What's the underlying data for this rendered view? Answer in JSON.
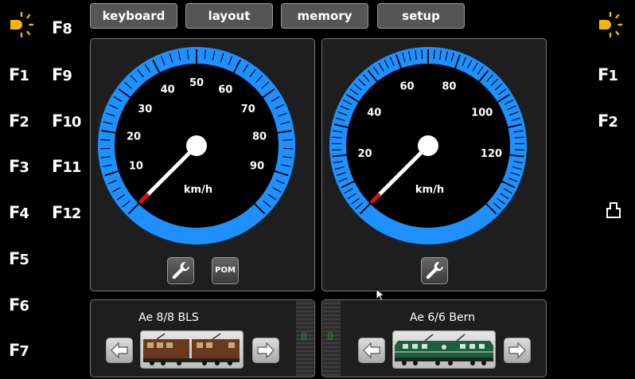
{
  "top_buttons": [
    {
      "label": "keyboard"
    },
    {
      "label": "layout"
    },
    {
      "label": "memory"
    },
    {
      "label": "setup"
    }
  ],
  "left_fkeys": [
    {
      "label": "F1"
    },
    {
      "label": "F2"
    },
    {
      "label": "F3"
    },
    {
      "label": "F4"
    },
    {
      "label": "F5"
    },
    {
      "label": "F6"
    },
    {
      "label": "F7"
    },
    {
      "label": "F8"
    },
    {
      "label": "F9"
    },
    {
      "label": "F10"
    },
    {
      "label": "F11"
    },
    {
      "label": "F12"
    }
  ],
  "right_fkeys": [
    {
      "label": "F1"
    },
    {
      "label": "F2"
    }
  ],
  "icons": {
    "light": "light-bulb-icon",
    "wrench": "wrench-icon",
    "coupler": "coupler-icon",
    "arrow_left": "arrow-left-icon",
    "arrow_right": "arrow-right-icon",
    "cursor": "mouse-cursor-icon"
  },
  "colors": {
    "gauge_ring": "#1e90ff",
    "needle": "#ffffff",
    "needle_tip": "#e01010",
    "light_on": "#f5b800",
    "meter_text": "#2a8a2a"
  },
  "throttles": [
    {
      "speed_unit": "km/h",
      "max_speed": 100,
      "current_speed": 0,
      "speed_labels": [
        10,
        20,
        30,
        40,
        50,
        60,
        70,
        80,
        90
      ],
      "pom_label": "POM",
      "loco_name": "Ae 8/8 BLS",
      "step_value": "0"
    },
    {
      "speed_unit": "km/h",
      "max_speed": 140,
      "current_speed": 0,
      "speed_labels": [
        20,
        40,
        60,
        80,
        100,
        120
      ],
      "loco_name": "Ae 6/6 Bern",
      "step_value": "0"
    }
  ]
}
